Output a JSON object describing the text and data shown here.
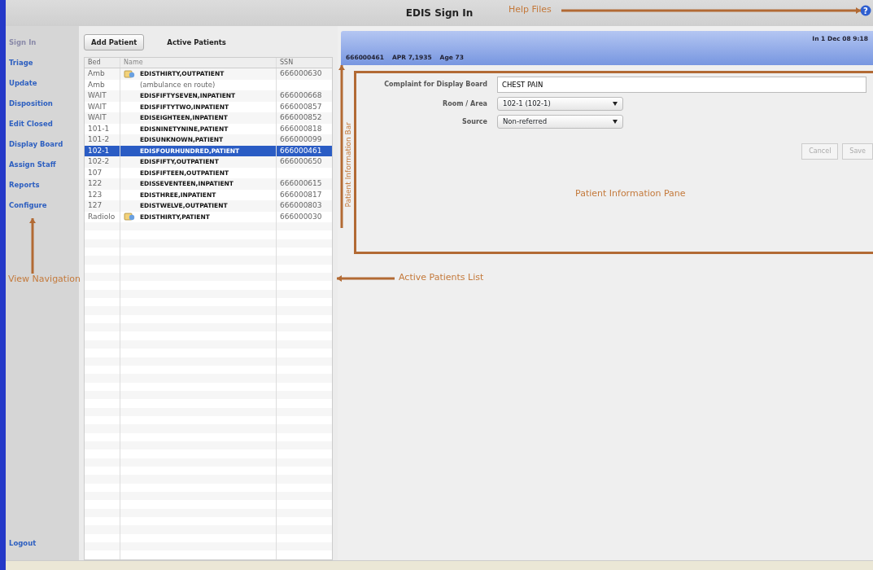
{
  "window": {
    "title": "EDIS Sign In",
    "help_glyph": "?"
  },
  "sidebar": {
    "items": [
      {
        "label": "Sign In",
        "selected": true
      },
      {
        "label": "Triage",
        "selected": false
      },
      {
        "label": "Update",
        "selected": false
      },
      {
        "label": "Disposition",
        "selected": false
      },
      {
        "label": "Edit Closed",
        "selected": false
      },
      {
        "label": "Display Board",
        "selected": false
      },
      {
        "label": "Assign Staff",
        "selected": false
      },
      {
        "label": "Reports",
        "selected": false
      },
      {
        "label": "Configure",
        "selected": false
      }
    ],
    "logout": "Logout"
  },
  "patients": {
    "add_button": "Add Patient",
    "title": "Active Patients",
    "columns": [
      "Bed",
      "Name",
      "SSN"
    ],
    "rows": [
      {
        "kind": "patient",
        "bed": "Amb",
        "icon": true,
        "name": "EDISTHIRTY,OUTPATIENT",
        "ssn": "666000630",
        "selected": false
      },
      {
        "kind": "note",
        "bed": "Amb",
        "icon": false,
        "name": "(ambulance en route)",
        "selected": false
      },
      {
        "kind": "patient",
        "bed": "WAIT",
        "icon": false,
        "name": "EDISFIFTYSEVEN,INPATIENT",
        "ssn": "666000668",
        "selected": false
      },
      {
        "kind": "patient",
        "bed": "WAIT",
        "icon": false,
        "name": "EDISFIFTYTWO,INPATIENT",
        "ssn": "666000857",
        "selected": false
      },
      {
        "kind": "patient",
        "bed": "WAIT",
        "icon": false,
        "name": "EDISEIGHTEEN,INPATIENT",
        "ssn": "666000852",
        "selected": false
      },
      {
        "kind": "patient",
        "bed": "101-1",
        "icon": false,
        "name": "EDISNINETYNINE,PATIENT",
        "ssn": "666000818",
        "selected": false
      },
      {
        "kind": "patient",
        "bed": "101-2",
        "icon": false,
        "name": "EDISUNKNOWN,PATIENT",
        "ssn": "666000099",
        "selected": false
      },
      {
        "kind": "patient",
        "bed": "102-1",
        "icon": false,
        "name": "EDISFOURHUNDRED,PATIENT",
        "ssn": "666000461",
        "selected": true
      },
      {
        "kind": "patient",
        "bed": "102-2",
        "icon": false,
        "name": "EDISFIFTY,OUTPATIENT",
        "ssn": "666000650",
        "selected": false
      },
      {
        "kind": "patient",
        "bed": "107",
        "icon": false,
        "name": "EDISFIFTEEN,OUTPATIENT",
        "selected": false
      },
      {
        "kind": "patient",
        "bed": "122",
        "icon": false,
        "name": "EDISSEVENTEEN,INPATIENT",
        "ssn": "666000615",
        "selected": false
      },
      {
        "kind": "patient",
        "bed": "123",
        "icon": false,
        "name": "EDISTHREE,INPATIENT",
        "ssn": "666000817",
        "selected": false
      },
      {
        "kind": "patient",
        "bed": "127",
        "icon": false,
        "name": "EDISTWELVE,OUTPATIENT",
        "ssn": "666000803",
        "selected": false
      },
      {
        "kind": "patient",
        "bed": "Radiolo",
        "icon": true,
        "name": "EDISTHIRTY,PATIENT",
        "ssn": "666000030",
        "selected": false
      }
    ]
  },
  "info_bar": {
    "ssn": "666000461",
    "dob": "APR 7,1935",
    "age": "Age 73",
    "arrival": "In 1 Dec 08 9:18"
  },
  "form": {
    "fields": [
      {
        "kind": "text",
        "label": "Complaint for Display Board",
        "value": "CHEST PAIN"
      },
      {
        "kind": "select",
        "label": "Room / Area",
        "value": "102-1  (102-1)"
      },
      {
        "kind": "select",
        "label": "Source",
        "value": "Non-referred"
      }
    ],
    "buttons": [
      {
        "label": "Cancel",
        "disabled": true
      },
      {
        "label": "Save",
        "disabled": true
      }
    ]
  },
  "annotations": {
    "help": "Help Files",
    "info_bar": "Patient Information Bar",
    "pane": "Patient Information Pane",
    "list": "Active Patients List",
    "nav": "View Navigation"
  }
}
